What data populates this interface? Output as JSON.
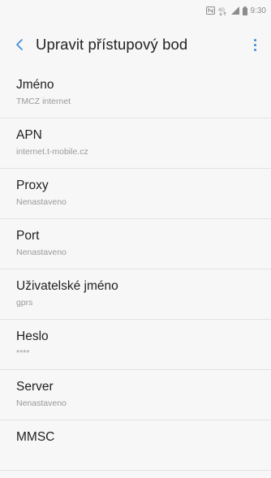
{
  "status_bar": {
    "time": "9:30",
    "icons": [
      "nfc-icon",
      "lte-icon",
      "signal-icon",
      "battery-icon"
    ],
    "lte_label": "4G"
  },
  "header": {
    "title": "Upravit přístupový bod",
    "accent_color": "#3d8bd6"
  },
  "fields": [
    {
      "label": "Jméno",
      "value": "TMCZ internet"
    },
    {
      "label": "APN",
      "value": "internet.t-mobile.cz"
    },
    {
      "label": "Proxy",
      "value": "Nenastaveno"
    },
    {
      "label": "Port",
      "value": "Nenastaveno"
    },
    {
      "label": "Uživatelské jméno",
      "value": "gprs"
    },
    {
      "label": "Heslo",
      "value": "****"
    },
    {
      "label": "Server",
      "value": "Nenastaveno"
    },
    {
      "label": "MMSC",
      "value": ""
    }
  ]
}
